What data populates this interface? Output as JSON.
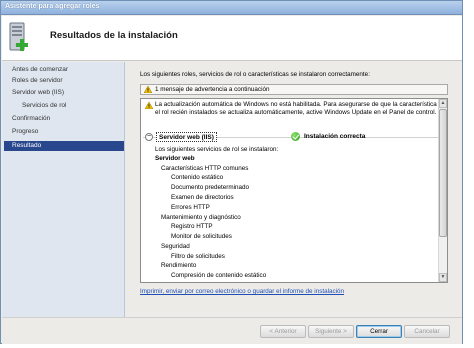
{
  "window": {
    "title": "Asistente para agregar roles",
    "heading": "Resultados de la instalación"
  },
  "nav": {
    "items": [
      {
        "label": "Antes de comenzar"
      },
      {
        "label": "Roles de servidor"
      },
      {
        "label": "Servidor web (IIS)"
      },
      {
        "label": "Servicios de rol"
      },
      {
        "label": "Confirmación"
      },
      {
        "label": "Progreso"
      },
      {
        "label": "Resultado"
      }
    ],
    "active": "Resultado"
  },
  "main": {
    "intro": "Los siguientes roles, servicios de rol o características se instalaron correctamente:",
    "warning_summary": "1 mensaje de advertencia a continuación",
    "warning_message": "La actualización automática de Windows no está habilitada. Para asegurarse de que la característica o el rol recién instalados se actualiza automáticamente, active Windows Update en el Panel de control.",
    "role": {
      "name": "Servidor web (IIS)",
      "status": "Instalación correcta"
    },
    "services_intro": "Los siguientes servicios de rol se instalaron:",
    "services": [
      {
        "label": "Servidor web",
        "level": 0
      },
      {
        "label": "Características HTTP comunes",
        "level": 1
      },
      {
        "label": "Contenido estático",
        "level": 2
      },
      {
        "label": "Documento predeterminado",
        "level": 2
      },
      {
        "label": "Examen de directorios",
        "level": 2
      },
      {
        "label": "Errores HTTP",
        "level": 2
      },
      {
        "label": "Mantenimiento y diagnóstico",
        "level": 1
      },
      {
        "label": "Registro HTTP",
        "level": 2
      },
      {
        "label": "Monitor de solicitudes",
        "level": 2
      },
      {
        "label": "Seguridad",
        "level": 1
      },
      {
        "label": "Filtro de solicitudes",
        "level": 2
      },
      {
        "label": "Rendimiento",
        "level": 1
      },
      {
        "label": "Compresión de contenido estático",
        "level": 2
      }
    ],
    "link": "Imprimir, enviar por correo electrónico o guardar el informe de instalación"
  },
  "footer": {
    "previous": "< Anterior",
    "next": "Siguiente >",
    "close": "Cerrar",
    "cancel": "Cancelar"
  },
  "colors": {
    "active_nav": "#29478d",
    "nav_background": "#dfe6ef",
    "link": "#1f4fb5",
    "success": "#2b9a1d",
    "warning": "#f2c200"
  }
}
